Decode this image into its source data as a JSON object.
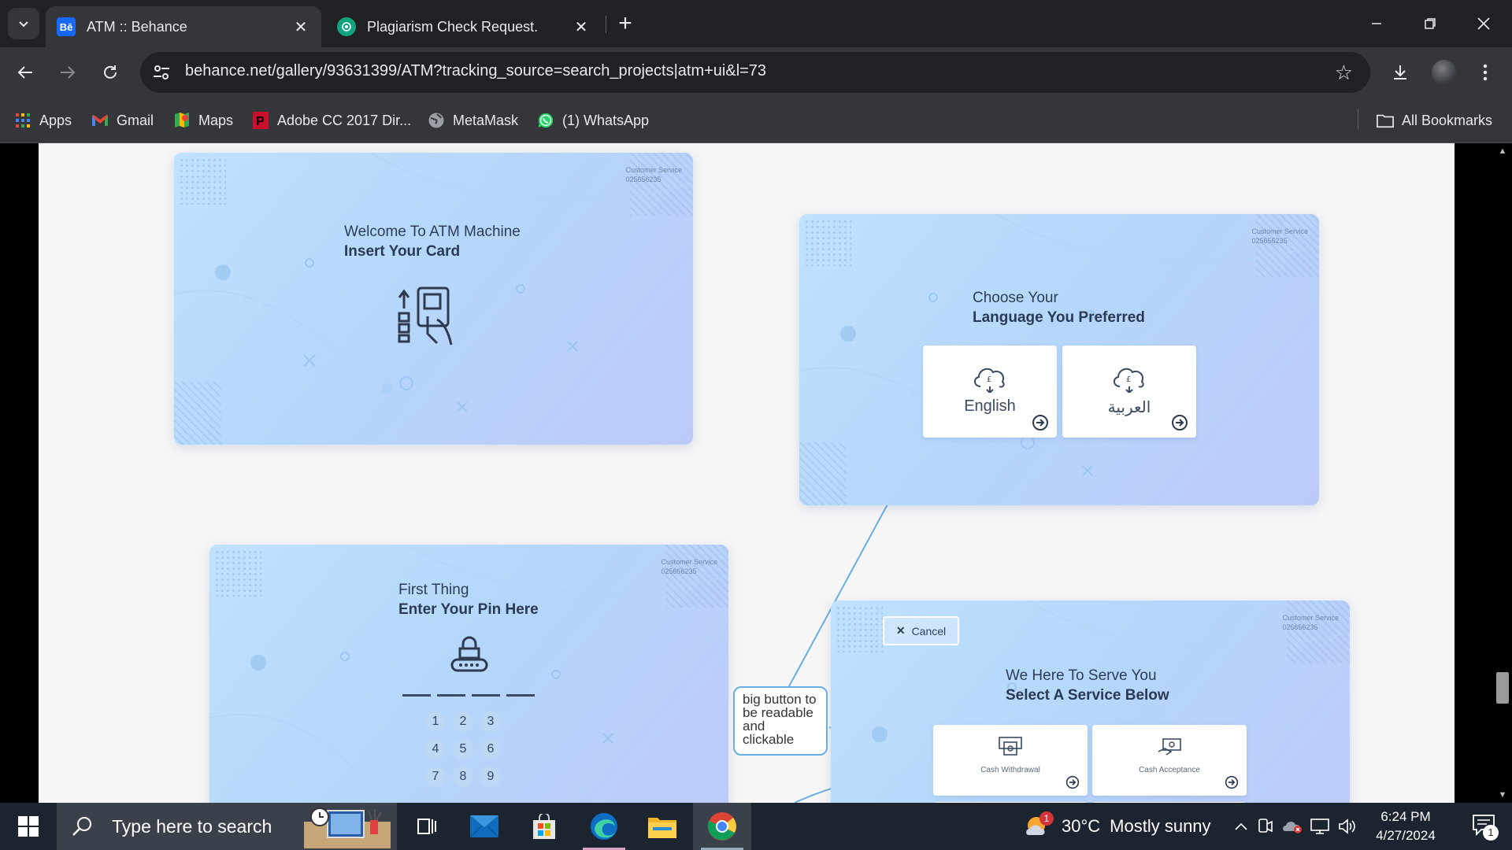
{
  "browser": {
    "tabs": [
      {
        "title": "ATM :: Behance",
        "favicon": "Bē",
        "favicon_color": "#1769ff"
      },
      {
        "title": "Plagiarism Check Request.",
        "favicon_color": "#10a37f"
      }
    ],
    "url": "behance.net/gallery/93631399/ATM?tracking_source=search_projects|atm+ui&l=73",
    "bookmarks": [
      {
        "label": "Apps",
        "icon": "apps-grid-icon"
      },
      {
        "label": "Gmail",
        "icon": "gmail-icon"
      },
      {
        "label": "Maps",
        "icon": "maps-icon"
      },
      {
        "label": "Adobe CC 2017 Dir...",
        "icon": "pinterest-icon"
      },
      {
        "label": "MetaMask",
        "icon": "globe-icon"
      },
      {
        "label": "(1) WhatsApp",
        "icon": "whatsapp-icon"
      }
    ],
    "all_bookmarks": "All Bookmarks"
  },
  "page": {
    "customer_service": {
      "label": "Customer Service",
      "number": "025656235"
    },
    "screen_welcome": {
      "line1": "Welcome To ATM Machine",
      "line2": "Insert Your Card"
    },
    "screen_language": {
      "line1": "Choose Your",
      "line2": "Language You Preferred",
      "english": "English",
      "arabic": "العربية"
    },
    "screen_pin": {
      "line1": "First Thing",
      "line2": "Enter Your Pin Here",
      "keys": [
        "1",
        "2",
        "3",
        "4",
        "5",
        "6",
        "7",
        "8",
        "9"
      ]
    },
    "screen_service": {
      "cancel": "Cancel",
      "line1": "We Here To Serve You",
      "line2": "Select A Service Below",
      "services": [
        "Cash Withdrawal",
        "Cash Acceptance"
      ]
    },
    "annotation": "big button to be readable and clickable"
  },
  "taskbar": {
    "search_placeholder": "Type here to search",
    "weather": {
      "temp": "30°C",
      "condition": "Mostly sunny",
      "badge": "1"
    },
    "time": "6:24 PM",
    "date": "4/27/2024",
    "notification_count": "1"
  },
  "colors": {
    "accent_behance": "#1769ff",
    "screen_bg": "#b8dbfd",
    "taskbar": "#1c2430",
    "chrome_dark": "#202124"
  }
}
